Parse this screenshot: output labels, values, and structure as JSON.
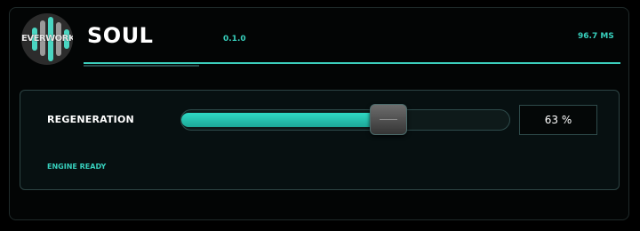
{
  "app": {
    "logo_text": "EVERWORKS",
    "title": "SOUL",
    "version": "0.1.0",
    "latency": "96.7 MS"
  },
  "parameter": {
    "label": "REGENERATION",
    "value_percent": 63,
    "value_display": "63 %"
  },
  "status": {
    "text": "ENGINE READY"
  },
  "colors": {
    "accent": "#37d0bd",
    "background": "#000000",
    "panel": "#071011"
  },
  "icons": {
    "logo": "everworks-logo-icon",
    "thumb": "slider-thumb-grip-icon"
  }
}
